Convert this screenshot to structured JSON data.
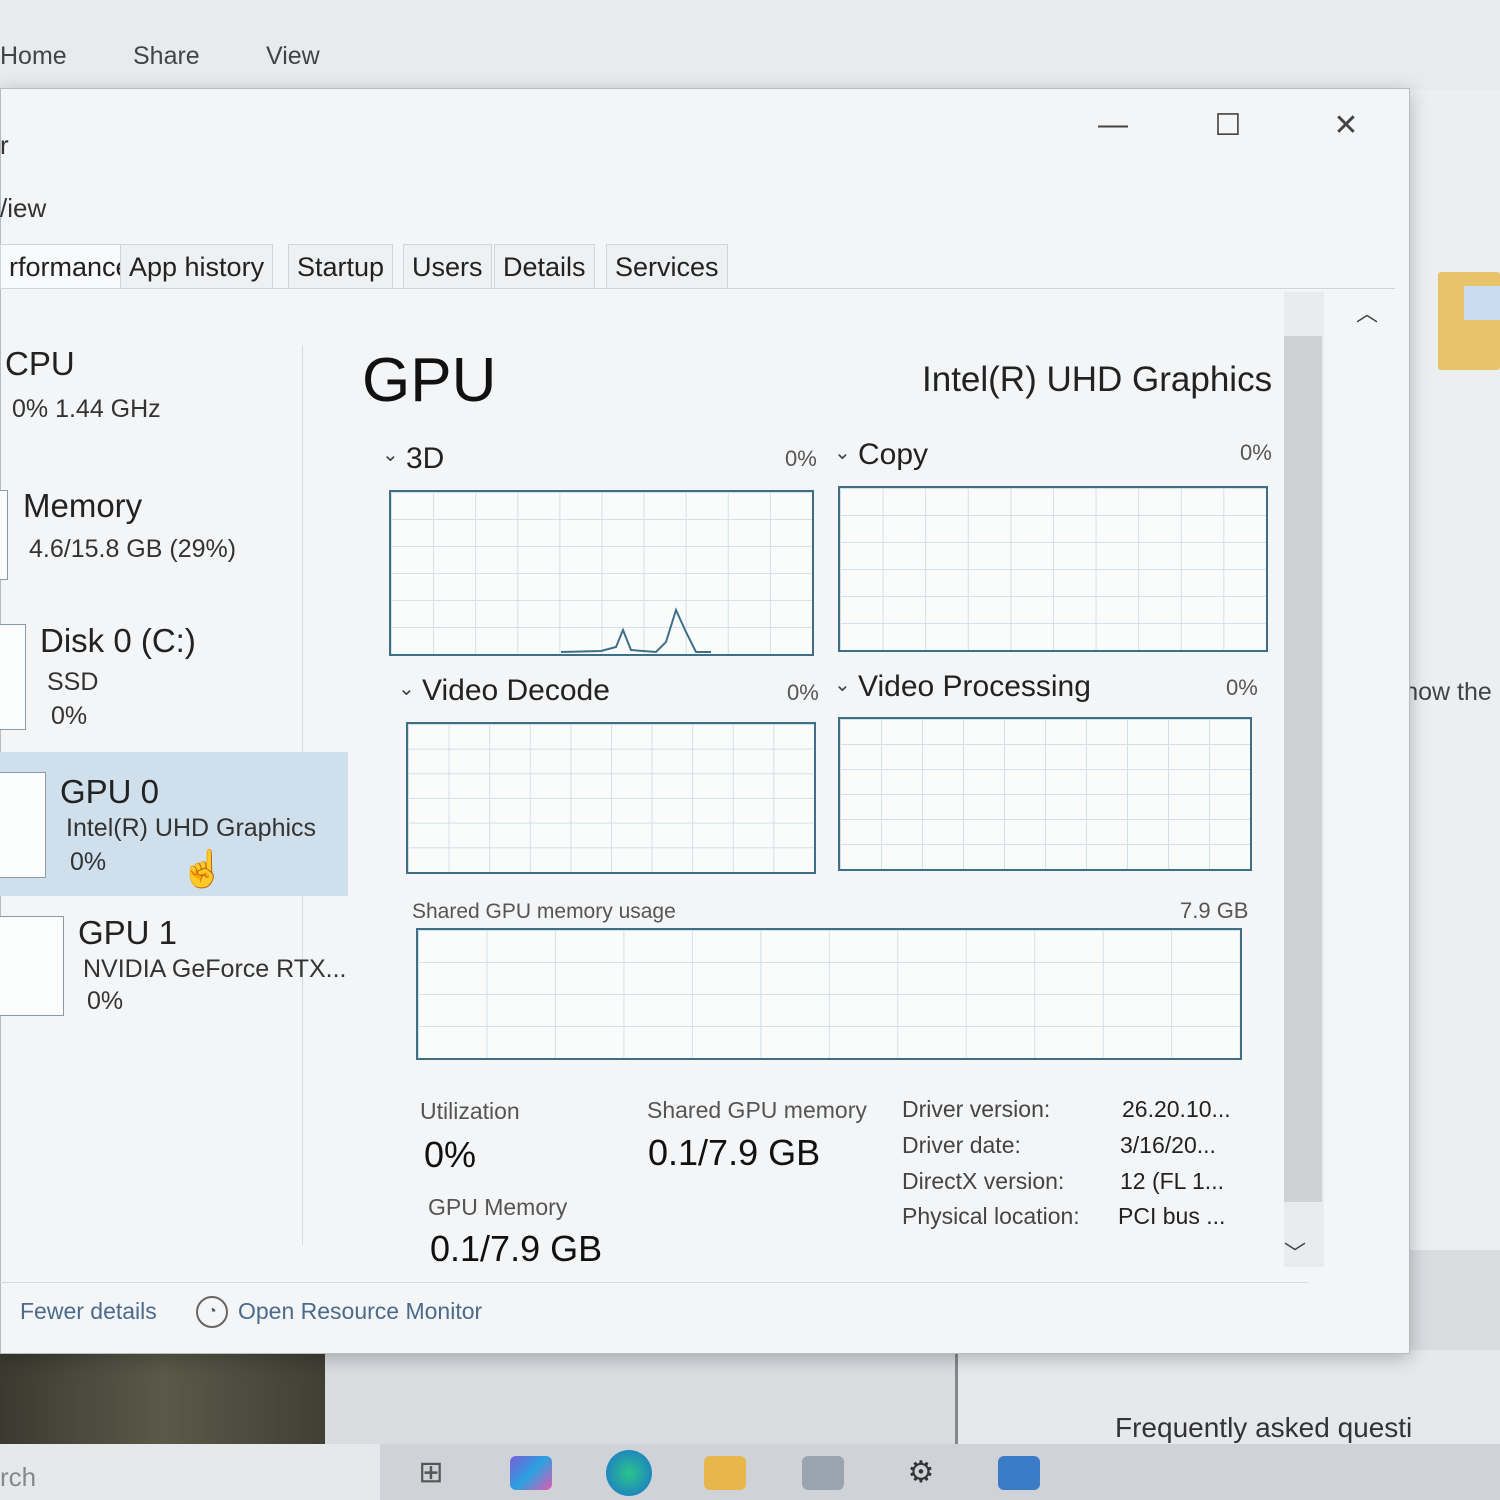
{
  "explorer": {
    "ribbon_tabs": [
      "Home",
      "Share",
      "View"
    ],
    "right_text": "e'll show the",
    "faq": "Frequently asked questi",
    "search": "rch"
  },
  "task_manager": {
    "window_buttons": {
      "minimize": "—",
      "maximize": "☐",
      "close": "✕"
    },
    "menu": {
      "file": "r",
      "view": "/iew"
    },
    "tabs": [
      "rformance",
      "App history",
      "Startup",
      "Users",
      "Details",
      "Services"
    ],
    "sidebar": [
      {
        "title": "CPU",
        "line1": "0%  1.44 GHz",
        "line2": ""
      },
      {
        "title": "Memory",
        "line1": "4.6/15.8 GB (29%)",
        "line2": ""
      },
      {
        "title": "Disk 0 (C:)",
        "line1": "SSD",
        "line2": "0%"
      },
      {
        "title": "GPU 0",
        "line1": "Intel(R) UHD Graphics",
        "line2": "0%"
      },
      {
        "title": "GPU 1",
        "line1": "NVIDIA GeForce RTX...",
        "line2": "0%"
      }
    ],
    "main": {
      "title": "GPU",
      "model": "Intel(R) UHD Graphics",
      "graphs": [
        {
          "label": "3D",
          "pct": "0%"
        },
        {
          "label": "Copy",
          "pct": "0%"
        },
        {
          "label": "Video Decode",
          "pct": "0%"
        },
        {
          "label": "Video Processing",
          "pct": "0%"
        }
      ],
      "shared_memory_graph": {
        "label": "Shared GPU memory usage",
        "max": "7.9 GB"
      },
      "stats": {
        "utilization_label": "Utilization",
        "utilization_value": "0%",
        "shared_label": "Shared GPU memory",
        "shared_value": "0.1/7.9 GB",
        "gpu_mem_label": "GPU Memory",
        "gpu_mem_value": "0.1/7.9 GB"
      },
      "info": [
        {
          "label": "Driver version:",
          "value": "26.20.10..."
        },
        {
          "label": "Driver date:",
          "value": "3/16/20..."
        },
        {
          "label": "DirectX version:",
          "value": "12 (FL 1..."
        },
        {
          "label": "Physical location:",
          "value": "PCI bus ..."
        }
      ]
    },
    "footer": {
      "fewer_details": "Fewer details",
      "open_resource_monitor": "Open Resource Monitor"
    }
  },
  "colors": {
    "graph_border": "#3f6f86",
    "selected_bg": "#cfe0ec",
    "link": "#4a6b8a"
  },
  "icons": [
    "minimize-icon",
    "maximize-icon",
    "close-icon",
    "chevron-down-icon",
    "scroll-up-icon",
    "scroll-down-icon",
    "resource-monitor-icon",
    "hand-cursor-icon",
    "folder-icon"
  ]
}
